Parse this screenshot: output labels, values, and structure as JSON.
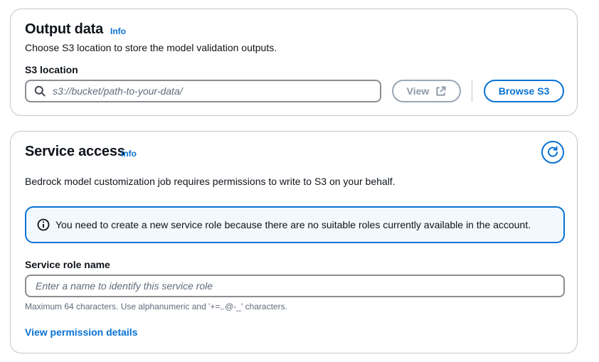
{
  "output_data": {
    "title": "Output data",
    "info": "Info",
    "description": "Choose S3 location to store the model validation outputs.",
    "s3_label": "S3 location",
    "s3_placeholder": "s3://bucket/path-to-your-data/",
    "view_button": "View",
    "browse_button": "Browse S3"
  },
  "service_access": {
    "title": "Service access",
    "info": "Info",
    "description": "Bedrock model customization job requires permissions to write to S3 on your behalf.",
    "alert_text": "You need to create a new service role because there are no suitable roles currently available in the account.",
    "role_label": "Service role name",
    "role_placeholder": "Enter a name to identify this service role",
    "role_hint": "Maximum 64 characters. Use alphanumeric and '+=,.@-_' characters.",
    "permission_link": "View permission details"
  },
  "icons": {
    "search": "search-icon",
    "external": "external-link-icon",
    "refresh": "refresh-icon",
    "info": "info-circle-icon"
  },
  "colors": {
    "accent": "#0972d3",
    "text": "#0f141a",
    "muted": "#5f6b7a",
    "border": "#c6c6cd",
    "alert_bg": "#f2f8fd"
  }
}
